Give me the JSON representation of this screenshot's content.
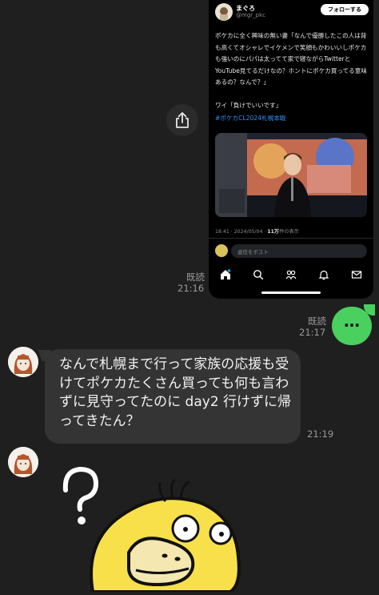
{
  "embedded_post": {
    "display_name": "まぐろ",
    "handle": "@mgr_pkc",
    "follow_label": "フォローする",
    "body": "ポケカに全く興味の無い妻「なんで優勝したこの人は背も高くてオシャレでイケメンで笑顔もかわいいしポケカも強いのにパパは太ってて家で寝ながらTwitterとYouTube見てるだけなの？ホントにポケカ買ってる意味あるの？なんで？」\n\nワイ「負けでいいです」",
    "hashtag": "#ポケカCL2024札幌本戦",
    "timestamp": "18:41 · 2024/05/04 · ",
    "views": "11万",
    "views_suffix": "件の表示",
    "reply_placeholder": "返信をポスト"
  },
  "messages": {
    "image_read": "既読",
    "image_time": "21:16",
    "sent_read": "既読",
    "sent_time": "21:17",
    "sent_dots": "…",
    "received_text": "なんで札幌まで行って家族の応援も受けてポケカたくさん買っても何も言わずに見守ってたのに day2 行けずに帰ってきたん？",
    "received_time": "21:19"
  },
  "colors": {
    "background": "#1f1f1f",
    "sent_bubble": "#4ad05e",
    "received_bubble": "#343434",
    "hashtag": "#2f8ff0",
    "sticker_yellow": "#f8e04a"
  }
}
